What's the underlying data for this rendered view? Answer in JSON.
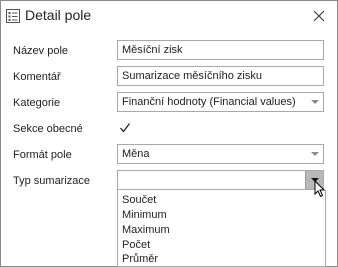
{
  "window": {
    "title": "Detail pole"
  },
  "fields": {
    "nazev": {
      "label": "Název pole",
      "value": "Měsíční zisk"
    },
    "komentar": {
      "label": "Komentář",
      "value": "Sumarizace měsíčního zisku"
    },
    "kategorie": {
      "label": "Kategorie",
      "value": "Finanční hodnoty (Financial values)"
    },
    "sekce": {
      "label": "Sekce obecné",
      "checked": true
    },
    "format": {
      "label": "Formát pole",
      "value": "Měna"
    },
    "typ": {
      "label": "Typ sumarizace",
      "value": ""
    }
  },
  "dropdown": {
    "options": [
      "Součet",
      "Minimum",
      "Maximum",
      "Počet",
      "Průměr"
    ]
  },
  "icons": {
    "title": "form-icon",
    "close": "close-icon",
    "check": "check-icon",
    "arrow": "chevron-down-icon",
    "cursor": "mouse-pointer-icon"
  }
}
